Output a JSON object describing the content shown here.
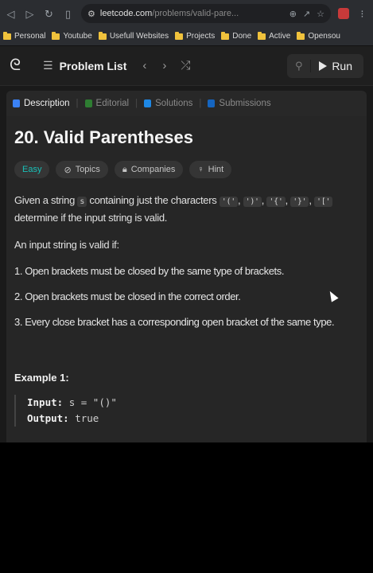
{
  "browser": {
    "url_host": "leetcode.com",
    "url_path": "/problems/valid-pare...",
    "bookmarks": [
      "Personal",
      "Youtube",
      "Usefull Websites",
      "Projects",
      "Done",
      "Active",
      "Opensou"
    ]
  },
  "nav": {
    "problem_list": "Problem List",
    "run": "Run"
  },
  "tabs": [
    {
      "label": "Description",
      "color": "#3b82f6"
    },
    {
      "label": "Editorial",
      "color": "#2e7d32"
    },
    {
      "label": "Solutions",
      "color": "#1e88e5"
    },
    {
      "label": "Submissions",
      "color": "#1565c0"
    }
  ],
  "problem": {
    "title": "20. Valid Parentheses",
    "difficulty": "Easy",
    "chips": [
      "Topics",
      "Companies",
      "Hint"
    ],
    "desc_line1_a": "Given a string",
    "desc_var": "s",
    "desc_line1_b": "containing just the characters",
    "desc_chars": [
      "'('",
      "')'",
      "'{'",
      "'}'",
      "'['"
    ],
    "desc_line2": "determine if the input string is valid.",
    "valid_if": "An input string is valid if:",
    "rules": [
      "1. Open brackets must be closed by the same type of brackets.",
      "2. Open brackets must be closed in the correct order.",
      "3. Every close bracket has a corresponding open bracket of the same type."
    ],
    "example_title": "Example 1:",
    "example_input_label": "Input:",
    "example_input_value": "s = \"()\"",
    "example_output_label": "Output:",
    "example_output_value": "true"
  }
}
